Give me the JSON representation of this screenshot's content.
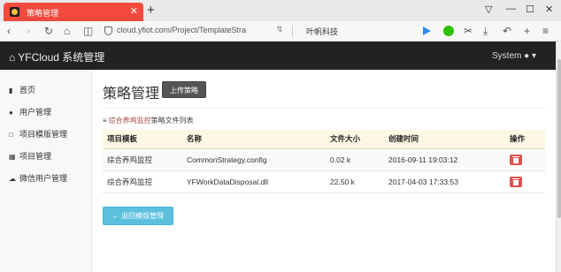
{
  "browser": {
    "tab_title": "策略管理",
    "tab_close": "✕",
    "new_tab": "+",
    "url": "cloud.yfiot.com/Project/TemplateStra",
    "search_text": "叶帆科技",
    "window_controls": [
      "▽",
      "—",
      "☐",
      "✕"
    ],
    "toolbar_icons": [
      "play-icon",
      "wechat-icon",
      "scissors-icon",
      "download-icon",
      "undo-icon",
      "plus-icon",
      "menu-icon"
    ]
  },
  "app": {
    "brand": "YFCloud 系统管理",
    "user": "System"
  },
  "sidebar": {
    "items": [
      {
        "label": "首页",
        "icon": "bar-chart-icon"
      },
      {
        "label": "用户管理",
        "icon": "user-icon"
      },
      {
        "label": "项目模版管理",
        "icon": "file-icon"
      },
      {
        "label": "项目管理",
        "icon": "grid-icon"
      },
      {
        "label": "微信用户管理",
        "icon": "cloud-icon"
      }
    ]
  },
  "main": {
    "title": "策略管理",
    "upload_label": "上传策略",
    "caption_link": "综合养鸡监控",
    "caption_text": "策略文件列表",
    "table": {
      "headers": [
        "项目模板",
        "名称",
        "文件大小",
        "创建时间",
        "操作"
      ],
      "rows": [
        {
          "template": "综合养鸡监控",
          "name": "CommonStrategy.config",
          "size": "0.02 k",
          "created": "2016-09-11 19:03:12"
        },
        {
          "template": "综合养鸡监控",
          "name": "YFWorkDataDisposal.dll",
          "size": "22.50 k",
          "created": "2017-04-03 17:33:53"
        }
      ]
    },
    "back_label": "返回模版管理"
  }
}
